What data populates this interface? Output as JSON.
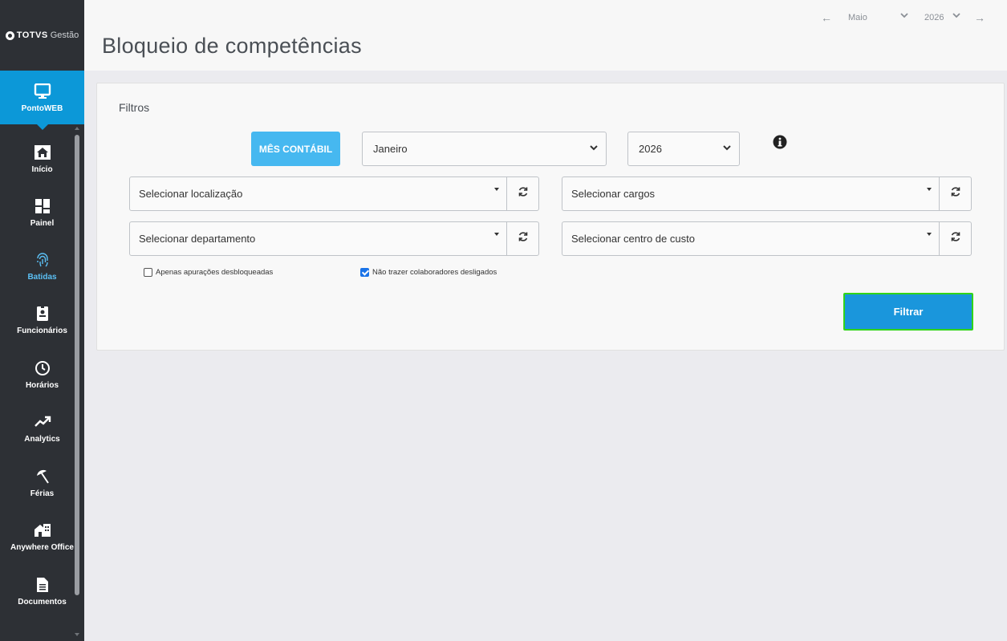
{
  "brand": {
    "mark": "TOTVS",
    "product": "Gestão"
  },
  "sidebar": {
    "items": [
      {
        "label": "PontoWEB",
        "icon": "monitor-icon",
        "active": true
      },
      {
        "label": "Início",
        "icon": "home-icon"
      },
      {
        "label": "Painel",
        "icon": "dashboard-icon"
      },
      {
        "label": "Batidas",
        "icon": "fingerprint-icon"
      },
      {
        "label": "Funcionários",
        "icon": "id-badge-icon"
      },
      {
        "label": "Horários",
        "icon": "clock-icon"
      },
      {
        "label": "Analytics",
        "icon": "trend-up-icon"
      },
      {
        "label": "Férias",
        "icon": "umbrella-beach-icon"
      },
      {
        "label": "Anywhere Office",
        "icon": "house-office-icon"
      },
      {
        "label": "Documentos",
        "icon": "document-icon"
      }
    ]
  },
  "header": {
    "title": "Bloqueio de competências",
    "period": {
      "month": "Maio",
      "year": "2026"
    }
  },
  "filters": {
    "title": "Filtros",
    "mes_contabil_label": "MÊS CONTÁBIL",
    "month_select": "Janeiro",
    "year_select": "2026",
    "localizacao": "Selecionar localização",
    "cargos": "Selecionar cargos",
    "departamento": "Selecionar departamento",
    "centro_custo": "Selecionar centro de custo",
    "checkbox_unlocked": {
      "label": "Apenas apurações desbloqueadas",
      "checked": false
    },
    "checkbox_no_dismissed": {
      "label": "Não trazer colaboradores desligados",
      "checked": true
    },
    "filter_button": "Filtrar"
  },
  "colors": {
    "sidebar_bg": "#2d3035",
    "active_nav": "#0c98d8",
    "mes_button": "#46b8f0",
    "filter_button": "#1a96dc",
    "filter_outline": "#31d419"
  }
}
